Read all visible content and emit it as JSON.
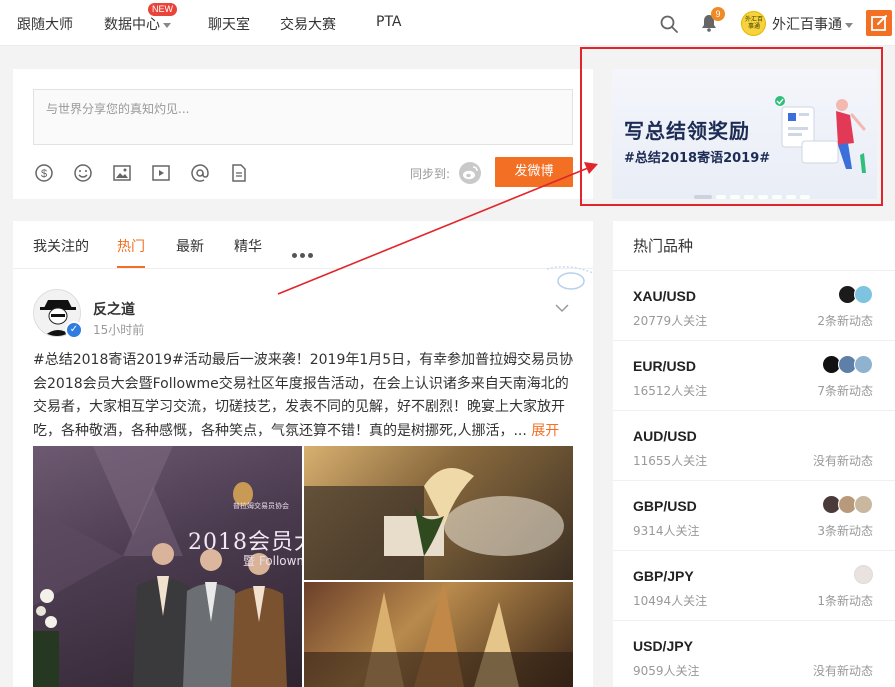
{
  "nav": {
    "items": [
      "跟随大师",
      "数据中心",
      "聊天室",
      "交易大赛",
      "PTA"
    ],
    "new_badge": "NEW",
    "bell_count": "9",
    "user_name": "外汇百事通",
    "avatar_text": "外汇百事通"
  },
  "compose": {
    "placeholder": "与世界分享您的真知灼见...",
    "sync_label": "同步到:",
    "post_button": "发微博",
    "tools": [
      "dollar-icon",
      "emoji-icon",
      "image-icon",
      "video-icon",
      "mention-icon",
      "document-icon"
    ]
  },
  "banner": {
    "title": "写总结领奖励",
    "subtitle": "#总结2018寄语2019#",
    "slide_count": 8,
    "active_slide": 1
  },
  "feed": {
    "tabs": [
      "我关注的",
      "热门",
      "最新",
      "精华"
    ],
    "active_tab": 1,
    "post": {
      "author": "反之道",
      "time": "15小时前",
      "text": "#总结2018寄语2019#活动最后一波来袭！2019年1月5日，有幸参加普拉姆交易员协会2018会员大会暨Followme交易社区年度报告活动，在会上认识诸多来自天南海北的交易者，大家相互学习交流，切磋技艺，发表不同的见解，好不剧烈！晚宴上大家放开吃，各种敬酒，各种感慨，各种笑点，气氛还算不错！真的是树挪死,人挪活，...",
      "expand": "展开",
      "photo_board_org": "普拉姆交易员协会",
      "photo_board_title": "2018会员大",
      "photo_board_sub": "暨 Followme交易社区年度"
    }
  },
  "hot": {
    "title": "热门品种",
    "rows": [
      {
        "symbol": "XAU/USD",
        "followers": "20779人关注",
        "news": "2条新动态",
        "faces": [
          "#1b1b1b",
          "#7ec3e0"
        ]
      },
      {
        "symbol": "EUR/USD",
        "followers": "16512人关注",
        "news": "7条新动态",
        "faces": [
          "#111111",
          "#5d7fa8",
          "#8fb3cf"
        ]
      },
      {
        "symbol": "AUD/USD",
        "followers": "11655人关注",
        "news": "没有新动态",
        "faces": []
      },
      {
        "symbol": "GBP/USD",
        "followers": "9314人关注",
        "news": "3条新动态",
        "faces": [
          "#4a3a3a",
          "#b89a7a",
          "#c9b7a0"
        ]
      },
      {
        "symbol": "GBP/JPY",
        "followers": "10494人关注",
        "news": "1条新动态",
        "faces": [
          "#e9e2de"
        ]
      },
      {
        "symbol": "USD/JPY",
        "followers": "9059人关注",
        "news": "没有新动态",
        "faces": []
      }
    ]
  },
  "colors": {
    "accent": "#f26f24",
    "highlight_frame": "#e2252b",
    "verified": "#2f7de1"
  }
}
